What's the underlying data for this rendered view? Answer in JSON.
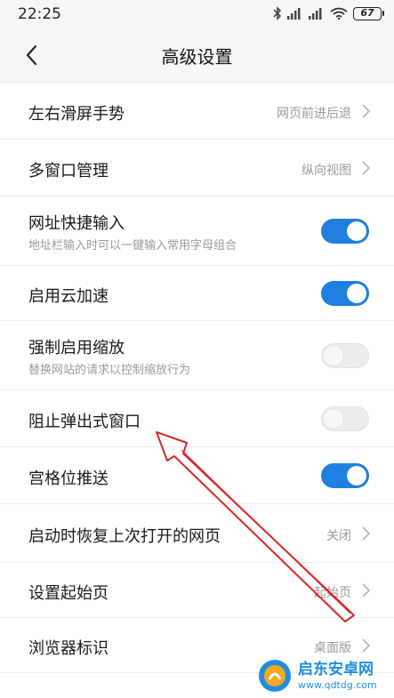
{
  "status_bar": {
    "time": "22:25",
    "battery": "67",
    "icons": [
      "bluetooth-icon",
      "signal-icon",
      "signal-icon",
      "wifi-icon",
      "battery-icon"
    ]
  },
  "header": {
    "title": "高级设置",
    "back_icon": "chevron-left-icon"
  },
  "settings": [
    {
      "title": "左右滑屏手势",
      "value": "网页前进后退",
      "type": "link"
    },
    {
      "title": "多窗口管理",
      "value": "纵向视图",
      "type": "link"
    },
    {
      "title": "网址快捷输入",
      "subtitle": "地址栏输入时可以一键输入常用字母组合",
      "type": "toggle",
      "enabled": true
    },
    {
      "title": "启用云加速",
      "type": "toggle",
      "enabled": true
    },
    {
      "title": "强制启用缩放",
      "subtitle": "替换网站的请求以控制缩放行为",
      "type": "toggle",
      "enabled": false
    },
    {
      "title": "阻止弹出式窗口",
      "type": "toggle",
      "enabled": false
    },
    {
      "title": "宫格位推送",
      "type": "toggle",
      "enabled": true
    },
    {
      "title": "启动时恢复上次打开的网页",
      "value": "关闭",
      "type": "link"
    },
    {
      "title": "设置起始页",
      "value": "起始页",
      "type": "link"
    },
    {
      "title": "浏览器标识",
      "value": "桌面版",
      "type": "link"
    }
  ],
  "colors": {
    "toggle_on": "#1f7fe0",
    "annotation_arrow": "#d62828"
  },
  "watermark": {
    "name": "启东安卓网",
    "url": "www.qdtdg.com"
  }
}
